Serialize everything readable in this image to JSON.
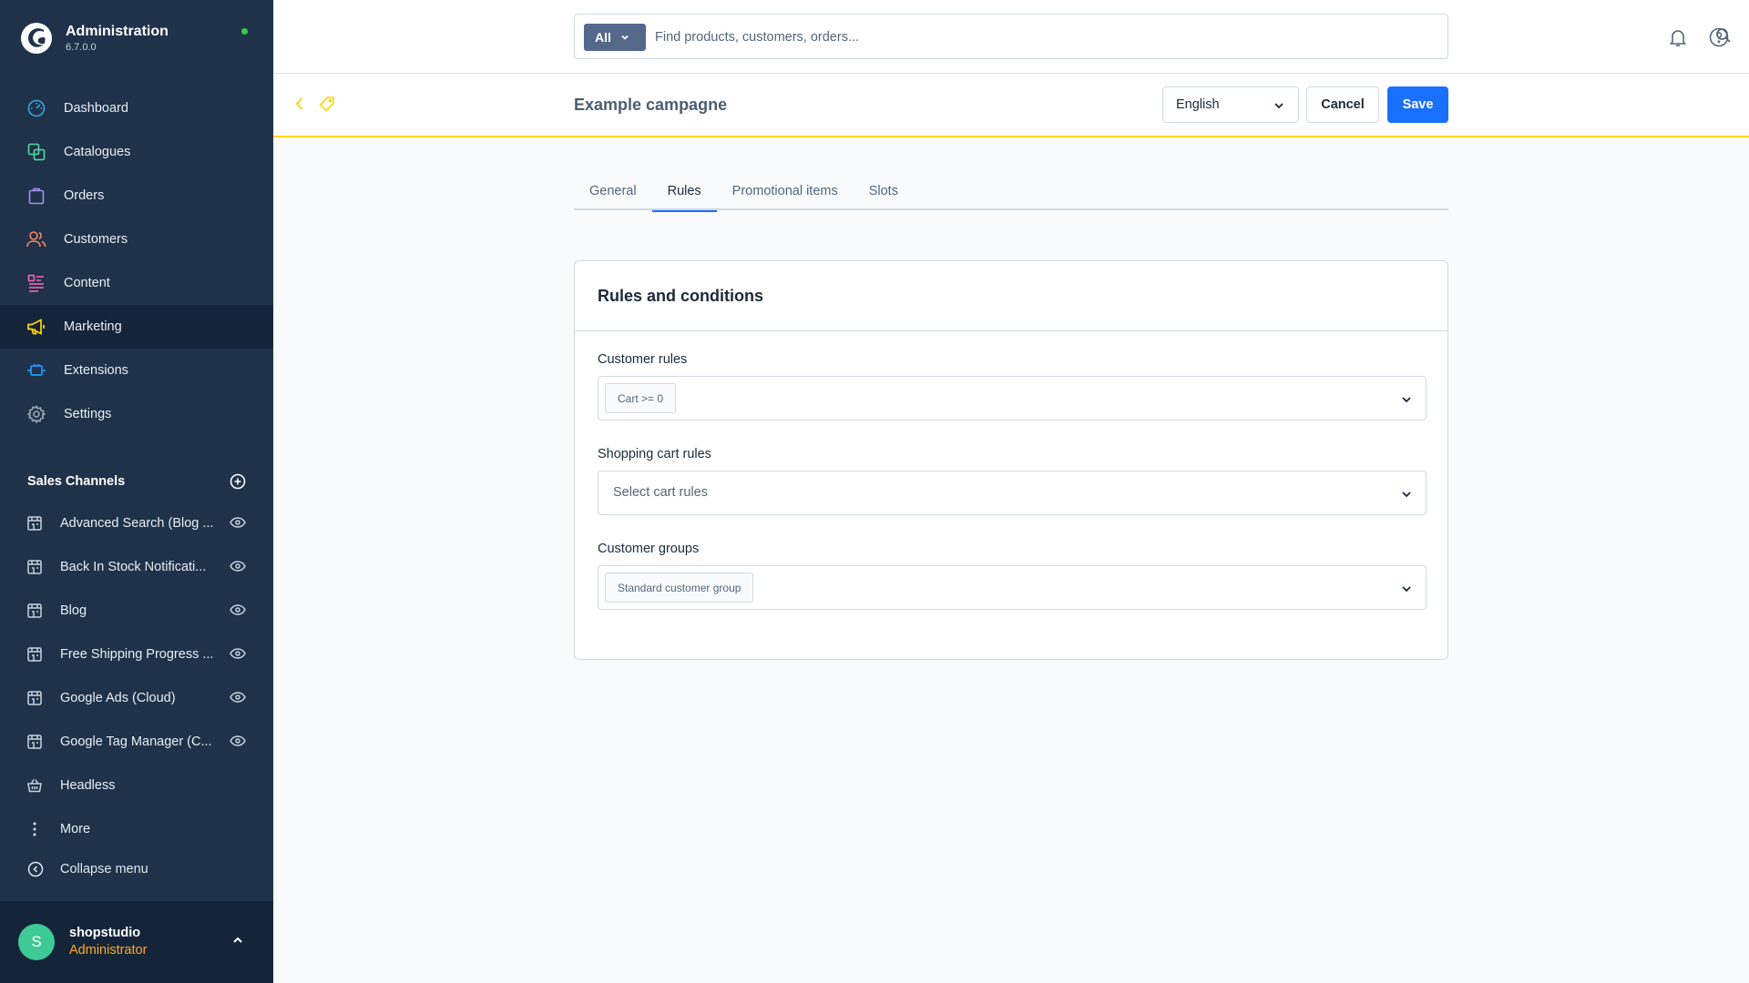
{
  "app": {
    "title": "Administration",
    "version": "6.7.0.0"
  },
  "nav": [
    {
      "label": "Dashboard",
      "icon": "dashboard-icon",
      "color": "#3ba6e0"
    },
    {
      "label": "Catalogues",
      "icon": "catalogues-icon",
      "color": "#57d9a3"
    },
    {
      "label": "Orders",
      "icon": "orders-icon",
      "color": "#a092f0"
    },
    {
      "label": "Customers",
      "icon": "customers-icon",
      "color": "#f88962"
    },
    {
      "label": "Content",
      "icon": "content-icon",
      "color": "#ff68b4"
    },
    {
      "label": "Marketing",
      "icon": "marketing-icon",
      "color": "#ffd700",
      "active": true
    },
    {
      "label": "Extensions",
      "icon": "extensions-icon",
      "color": "#189eff"
    },
    {
      "label": "Settings",
      "icon": "settings-icon",
      "color": "#9aa8b5"
    }
  ],
  "sales_channels": {
    "title": "Sales Channels",
    "items": [
      {
        "label": "Advanced Search (Blog ..."
      },
      {
        "label": "Back In Stock Notificati..."
      },
      {
        "label": "Blog"
      },
      {
        "label": "Free Shipping Progress ..."
      },
      {
        "label": "Google Ads (Cloud)"
      },
      {
        "label": "Google Tag Manager (C..."
      },
      {
        "label": "Headless"
      },
      {
        "label": "More"
      }
    ]
  },
  "collapse_label": "Collapse menu",
  "user": {
    "initial": "S",
    "name": "shopstudio",
    "role": "Administrator"
  },
  "search": {
    "type": "All",
    "placeholder": "Find products, customers, orders..."
  },
  "page": {
    "title": "Example campagne"
  },
  "language": {
    "selected": "English"
  },
  "buttons": {
    "cancel": "Cancel",
    "save": "Save"
  },
  "tabs": [
    {
      "label": "General"
    },
    {
      "label": "Rules",
      "active": true
    },
    {
      "label": "Promotional items"
    },
    {
      "label": "Slots"
    }
  ],
  "card": {
    "title": "Rules and conditions",
    "customer_rules": {
      "label": "Customer rules",
      "chip": "Cart >= 0"
    },
    "cart_rules": {
      "label": "Shopping cart rules",
      "placeholder": "Select cart rules"
    },
    "customer_groups": {
      "label": "Customer groups",
      "chip": "Standard customer group"
    }
  },
  "colors": {
    "sidebar": "#1f3249",
    "accent": "#1970ff",
    "marketing": "#ffd700",
    "online": "#37d046",
    "role": "#ffab1f"
  }
}
